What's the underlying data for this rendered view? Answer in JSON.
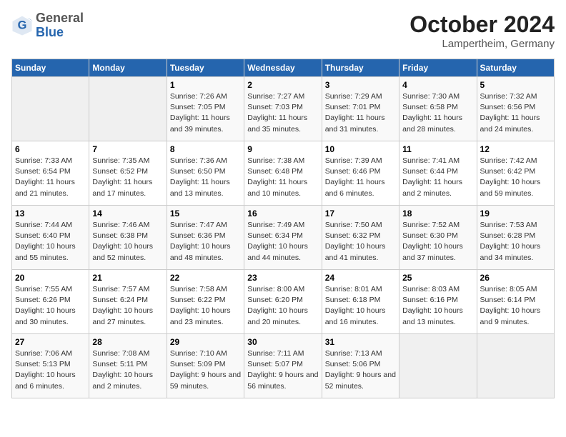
{
  "header": {
    "logo_general": "General",
    "logo_blue": "Blue",
    "month_title": "October 2024",
    "location": "Lampertheim, Germany"
  },
  "days_of_week": [
    "Sunday",
    "Monday",
    "Tuesday",
    "Wednesday",
    "Thursday",
    "Friday",
    "Saturday"
  ],
  "weeks": [
    [
      {
        "num": "",
        "sunrise": "",
        "sunset": "",
        "daylight": "",
        "empty": true
      },
      {
        "num": "",
        "sunrise": "",
        "sunset": "",
        "daylight": "",
        "empty": true
      },
      {
        "num": "1",
        "sunrise": "Sunrise: 7:26 AM",
        "sunset": "Sunset: 7:05 PM",
        "daylight": "Daylight: 11 hours and 39 minutes."
      },
      {
        "num": "2",
        "sunrise": "Sunrise: 7:27 AM",
        "sunset": "Sunset: 7:03 PM",
        "daylight": "Daylight: 11 hours and 35 minutes."
      },
      {
        "num": "3",
        "sunrise": "Sunrise: 7:29 AM",
        "sunset": "Sunset: 7:01 PM",
        "daylight": "Daylight: 11 hours and 31 minutes."
      },
      {
        "num": "4",
        "sunrise": "Sunrise: 7:30 AM",
        "sunset": "Sunset: 6:58 PM",
        "daylight": "Daylight: 11 hours and 28 minutes."
      },
      {
        "num": "5",
        "sunrise": "Sunrise: 7:32 AM",
        "sunset": "Sunset: 6:56 PM",
        "daylight": "Daylight: 11 hours and 24 minutes."
      }
    ],
    [
      {
        "num": "6",
        "sunrise": "Sunrise: 7:33 AM",
        "sunset": "Sunset: 6:54 PM",
        "daylight": "Daylight: 11 hours and 21 minutes."
      },
      {
        "num": "7",
        "sunrise": "Sunrise: 7:35 AM",
        "sunset": "Sunset: 6:52 PM",
        "daylight": "Daylight: 11 hours and 17 minutes."
      },
      {
        "num": "8",
        "sunrise": "Sunrise: 7:36 AM",
        "sunset": "Sunset: 6:50 PM",
        "daylight": "Daylight: 11 hours and 13 minutes."
      },
      {
        "num": "9",
        "sunrise": "Sunrise: 7:38 AM",
        "sunset": "Sunset: 6:48 PM",
        "daylight": "Daylight: 11 hours and 10 minutes."
      },
      {
        "num": "10",
        "sunrise": "Sunrise: 7:39 AM",
        "sunset": "Sunset: 6:46 PM",
        "daylight": "Daylight: 11 hours and 6 minutes."
      },
      {
        "num": "11",
        "sunrise": "Sunrise: 7:41 AM",
        "sunset": "Sunset: 6:44 PM",
        "daylight": "Daylight: 11 hours and 2 minutes."
      },
      {
        "num": "12",
        "sunrise": "Sunrise: 7:42 AM",
        "sunset": "Sunset: 6:42 PM",
        "daylight": "Daylight: 10 hours and 59 minutes."
      }
    ],
    [
      {
        "num": "13",
        "sunrise": "Sunrise: 7:44 AM",
        "sunset": "Sunset: 6:40 PM",
        "daylight": "Daylight: 10 hours and 55 minutes."
      },
      {
        "num": "14",
        "sunrise": "Sunrise: 7:46 AM",
        "sunset": "Sunset: 6:38 PM",
        "daylight": "Daylight: 10 hours and 52 minutes."
      },
      {
        "num": "15",
        "sunrise": "Sunrise: 7:47 AM",
        "sunset": "Sunset: 6:36 PM",
        "daylight": "Daylight: 10 hours and 48 minutes."
      },
      {
        "num": "16",
        "sunrise": "Sunrise: 7:49 AM",
        "sunset": "Sunset: 6:34 PM",
        "daylight": "Daylight: 10 hours and 44 minutes."
      },
      {
        "num": "17",
        "sunrise": "Sunrise: 7:50 AM",
        "sunset": "Sunset: 6:32 PM",
        "daylight": "Daylight: 10 hours and 41 minutes."
      },
      {
        "num": "18",
        "sunrise": "Sunrise: 7:52 AM",
        "sunset": "Sunset: 6:30 PM",
        "daylight": "Daylight: 10 hours and 37 minutes."
      },
      {
        "num": "19",
        "sunrise": "Sunrise: 7:53 AM",
        "sunset": "Sunset: 6:28 PM",
        "daylight": "Daylight: 10 hours and 34 minutes."
      }
    ],
    [
      {
        "num": "20",
        "sunrise": "Sunrise: 7:55 AM",
        "sunset": "Sunset: 6:26 PM",
        "daylight": "Daylight: 10 hours and 30 minutes."
      },
      {
        "num": "21",
        "sunrise": "Sunrise: 7:57 AM",
        "sunset": "Sunset: 6:24 PM",
        "daylight": "Daylight: 10 hours and 27 minutes."
      },
      {
        "num": "22",
        "sunrise": "Sunrise: 7:58 AM",
        "sunset": "Sunset: 6:22 PM",
        "daylight": "Daylight: 10 hours and 23 minutes."
      },
      {
        "num": "23",
        "sunrise": "Sunrise: 8:00 AM",
        "sunset": "Sunset: 6:20 PM",
        "daylight": "Daylight: 10 hours and 20 minutes."
      },
      {
        "num": "24",
        "sunrise": "Sunrise: 8:01 AM",
        "sunset": "Sunset: 6:18 PM",
        "daylight": "Daylight: 10 hours and 16 minutes."
      },
      {
        "num": "25",
        "sunrise": "Sunrise: 8:03 AM",
        "sunset": "Sunset: 6:16 PM",
        "daylight": "Daylight: 10 hours and 13 minutes."
      },
      {
        "num": "26",
        "sunrise": "Sunrise: 8:05 AM",
        "sunset": "Sunset: 6:14 PM",
        "daylight": "Daylight: 10 hours and 9 minutes."
      }
    ],
    [
      {
        "num": "27",
        "sunrise": "Sunrise: 7:06 AM",
        "sunset": "Sunset: 5:13 PM",
        "daylight": "Daylight: 10 hours and 6 minutes."
      },
      {
        "num": "28",
        "sunrise": "Sunrise: 7:08 AM",
        "sunset": "Sunset: 5:11 PM",
        "daylight": "Daylight: 10 hours and 2 minutes."
      },
      {
        "num": "29",
        "sunrise": "Sunrise: 7:10 AM",
        "sunset": "Sunset: 5:09 PM",
        "daylight": "Daylight: 9 hours and 59 minutes."
      },
      {
        "num": "30",
        "sunrise": "Sunrise: 7:11 AM",
        "sunset": "Sunset: 5:07 PM",
        "daylight": "Daylight: 9 hours and 56 minutes."
      },
      {
        "num": "31",
        "sunrise": "Sunrise: 7:13 AM",
        "sunset": "Sunset: 5:06 PM",
        "daylight": "Daylight: 9 hours and 52 minutes."
      },
      {
        "num": "",
        "sunrise": "",
        "sunset": "",
        "daylight": "",
        "empty": true
      },
      {
        "num": "",
        "sunrise": "",
        "sunset": "",
        "daylight": "",
        "empty": true
      }
    ]
  ]
}
